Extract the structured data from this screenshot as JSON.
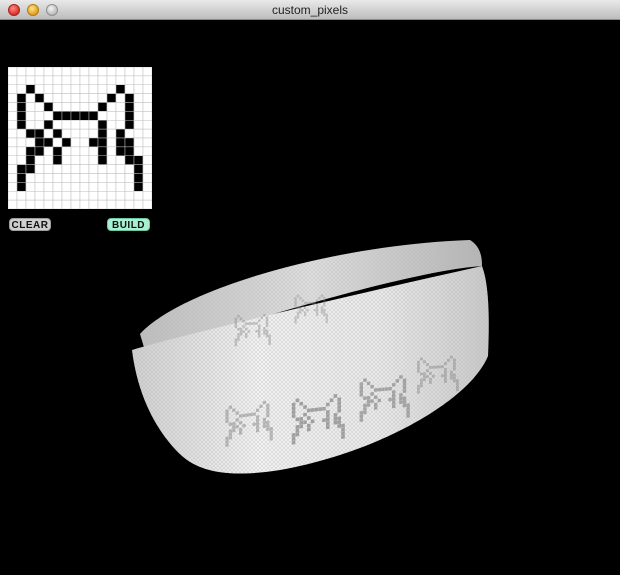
{
  "window": {
    "title": "custom_pixels"
  },
  "controls": {
    "clear_label": "CLEAR",
    "build_label": "BUILD"
  },
  "pattern": {
    "cols": 16,
    "rows": 16,
    "on_color": "#000000",
    "off_color": "#ffffff",
    "grid_color": "#bdbdbd",
    "bitmap": [
      "0000000000000000",
      "0000000000000000",
      "0010000000001000",
      "0101000000010100",
      "0100100000100100",
      "0100011111000100",
      "0100100000100100",
      "0011010000101000",
      "0001101001101100",
      "0011010000101100",
      "0010010000100110",
      "0110000000000010",
      "0100000000000010",
      "0100000000000010",
      "0000000000000000",
      "0000000000000000"
    ]
  },
  "ring": {
    "band_color": "#e6e6e6",
    "motif_count": 6
  }
}
